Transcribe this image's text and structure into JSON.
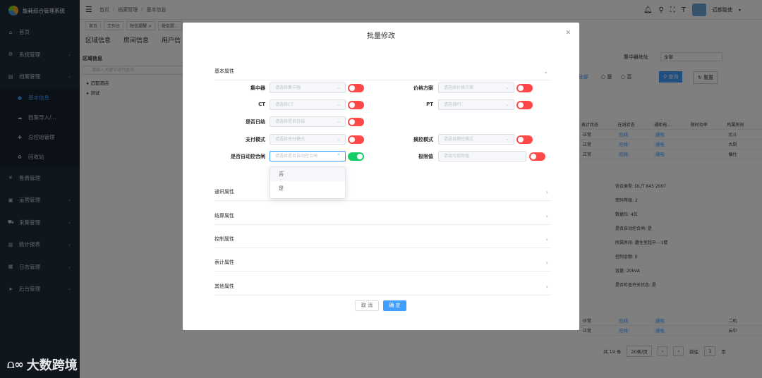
{
  "app": {
    "title": "能耗综合管理系统"
  },
  "sidebar": {
    "items": [
      {
        "label": "首页",
        "icon": "home-icon",
        "glyph": "⌂"
      },
      {
        "label": "系统管理",
        "icon": "gear-icon",
        "glyph": "⚙"
      },
      {
        "label": "档案管理",
        "icon": "archive-icon",
        "glyph": "▤"
      }
    ],
    "subitems": [
      {
        "label": "基本信息",
        "icon": "info-icon",
        "glyph": "●"
      },
      {
        "label": "档案导入/...",
        "icon": "cloud-icon",
        "glyph": "☁"
      },
      {
        "label": "总控组管理",
        "icon": "plus-circle-icon",
        "glyph": "✚"
      },
      {
        "label": "回收站",
        "icon": "recycle-icon",
        "glyph": "♻"
      }
    ],
    "items2": [
      {
        "label": "售费管理",
        "icon": "yen-icon",
        "glyph": "¥"
      },
      {
        "label": "运营管理",
        "icon": "briefcase-icon",
        "glyph": "▣"
      },
      {
        "label": "采集管理",
        "icon": "cart-icon",
        "glyph": "⛟"
      },
      {
        "label": "统计报表",
        "icon": "bar-chart-icon",
        "glyph": "▥"
      },
      {
        "label": "日志管理",
        "icon": "calendar-icon",
        "glyph": "▦"
      },
      {
        "label": "后台管理",
        "icon": "send-icon",
        "glyph": "➤"
      }
    ]
  },
  "header": {
    "breadcrumbs": [
      "首页",
      "档案管理",
      "基本信息"
    ],
    "user": "迈都能使",
    "tags": [
      "首页",
      "工作台",
      "短信提醒 ×",
      "微信提..."
    ]
  },
  "content": {
    "tabs": [
      "区域信息",
      "房间信息",
      "用户信"
    ],
    "area_title": "区域信息",
    "area_search_placeholder": "请输入关键字进行查询",
    "tree": [
      "迈都酒店",
      "测试"
    ],
    "filter_label": "集中器地址",
    "filter_value": "全部",
    "radio_all": "全部",
    "radio_yes": "是",
    "radio_no": "否",
    "query": "查询",
    "reset": "重置",
    "table_headers": [
      "表计状态",
      "在线状态",
      "通断电...",
      "限时功率",
      "所属房间"
    ],
    "table_rows": [
      [
        "正常",
        "在线",
        "通电",
        "",
        "北斗"
      ],
      [
        "正常",
        "在线",
        "通电",
        "",
        "大厨"
      ],
      [
        "正常",
        "在线",
        "通电",
        "",
        "偏住"
      ]
    ],
    "table_rows2": [
      [
        "正常",
        "在线",
        "通电",
        "",
        "二机"
      ],
      [
        "正常",
        "在线",
        "通电",
        "",
        "云中"
      ]
    ],
    "detail": [
      "协议类型:  DL/T 645 2007",
      "密码等级:  2",
      "数据位:  4位",
      "是否自动控合闸:  是",
      "所属房间:  趣住室超市---1楼",
      "控制金额:  0",
      "容量:  20kVA",
      "是否检查开关状态:  是"
    ],
    "pager_total": "共 19 条",
    "pager_size": "20条/页",
    "pager_goto": "前往",
    "pager_page": "1",
    "pager_unit": "页"
  },
  "watermark": "大数跨境",
  "modal": {
    "title": "批量修改",
    "sections": {
      "basic": "基本属性",
      "comm": "通讯属性",
      "settle": "结算属性",
      "control": "控制属性",
      "meter": "表计属性",
      "other": "其他属性"
    },
    "fields": {
      "concentrator": {
        "label": "集中器",
        "placeholder": "请选择集中器"
      },
      "price": {
        "label": "价格方案",
        "placeholder": "请选择价格方案"
      },
      "ct": {
        "label": "CT",
        "placeholder": "请选择CT"
      },
      "pt": {
        "label": "PT",
        "placeholder": "请选择PT"
      },
      "daily": {
        "label": "是否日结",
        "placeholder": "请选择是否日结"
      },
      "paymode": {
        "label": "支付模式",
        "placeholder": "请选择支付模式"
      },
      "ctrlmode": {
        "label": "摘控模式",
        "placeholder": "请选择摘控模式"
      },
      "autoclose": {
        "label": "是否自动控合闸",
        "placeholder": "请选择是否自动控合闸"
      },
      "limit": {
        "label": "极限值",
        "placeholder": "请填写极限值"
      }
    },
    "dropdown_options": [
      "否",
      "是"
    ],
    "cancel": "取 消",
    "ok": "确 定",
    "switch_on_color": "#13ce66",
    "switch_off_color": "#ff4949"
  }
}
